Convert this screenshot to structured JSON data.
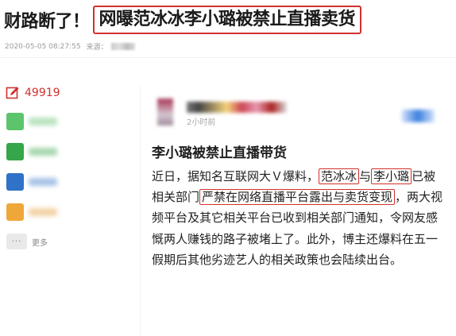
{
  "headline": {
    "prefix": "财路断了！",
    "boxed": "网曝范冰冰李小璐被禁止直播卖货"
  },
  "meta": {
    "date": "2020-05-05 08:27:55",
    "source_label": "来源："
  },
  "sidebar": {
    "comment_count": "49919",
    "share_items": [
      {
        "icon": "wechat-icon",
        "color": "#5cc56b"
      },
      {
        "icon": "moments-icon",
        "color": "#35a64a"
      },
      {
        "icon": "qzone-icon",
        "color": "#2f72c8"
      },
      {
        "icon": "weibo-icon",
        "color": "#f0a73a"
      }
    ],
    "more_label": "更多",
    "more_icon_text": "···"
  },
  "post": {
    "timestamp": "2小时前",
    "title": "李小璐被禁止直播带货",
    "body": [
      {
        "text": "近日，据知名互联网大Ｖ爆料，",
        "hl": false
      },
      {
        "text": "范冰冰",
        "hl": true
      },
      {
        "text": "与",
        "hl": false
      },
      {
        "text": "李小璐",
        "hl": true
      },
      {
        "text": "已被相关部门",
        "hl": false
      },
      {
        "text": "严禁在网络直播平台露出与卖货变现",
        "hl": true
      },
      {
        "text": "，两大视频平台及其它相关平台已收到相关部门通知，令网友感慨两人赚钱的路子被堵上了。此外，博主还爆料在五一假期后其他劣迹艺人的相关政策也会陆续出台。",
        "hl": false
      }
    ]
  },
  "colors": {
    "accent_red": "#d0312d"
  }
}
